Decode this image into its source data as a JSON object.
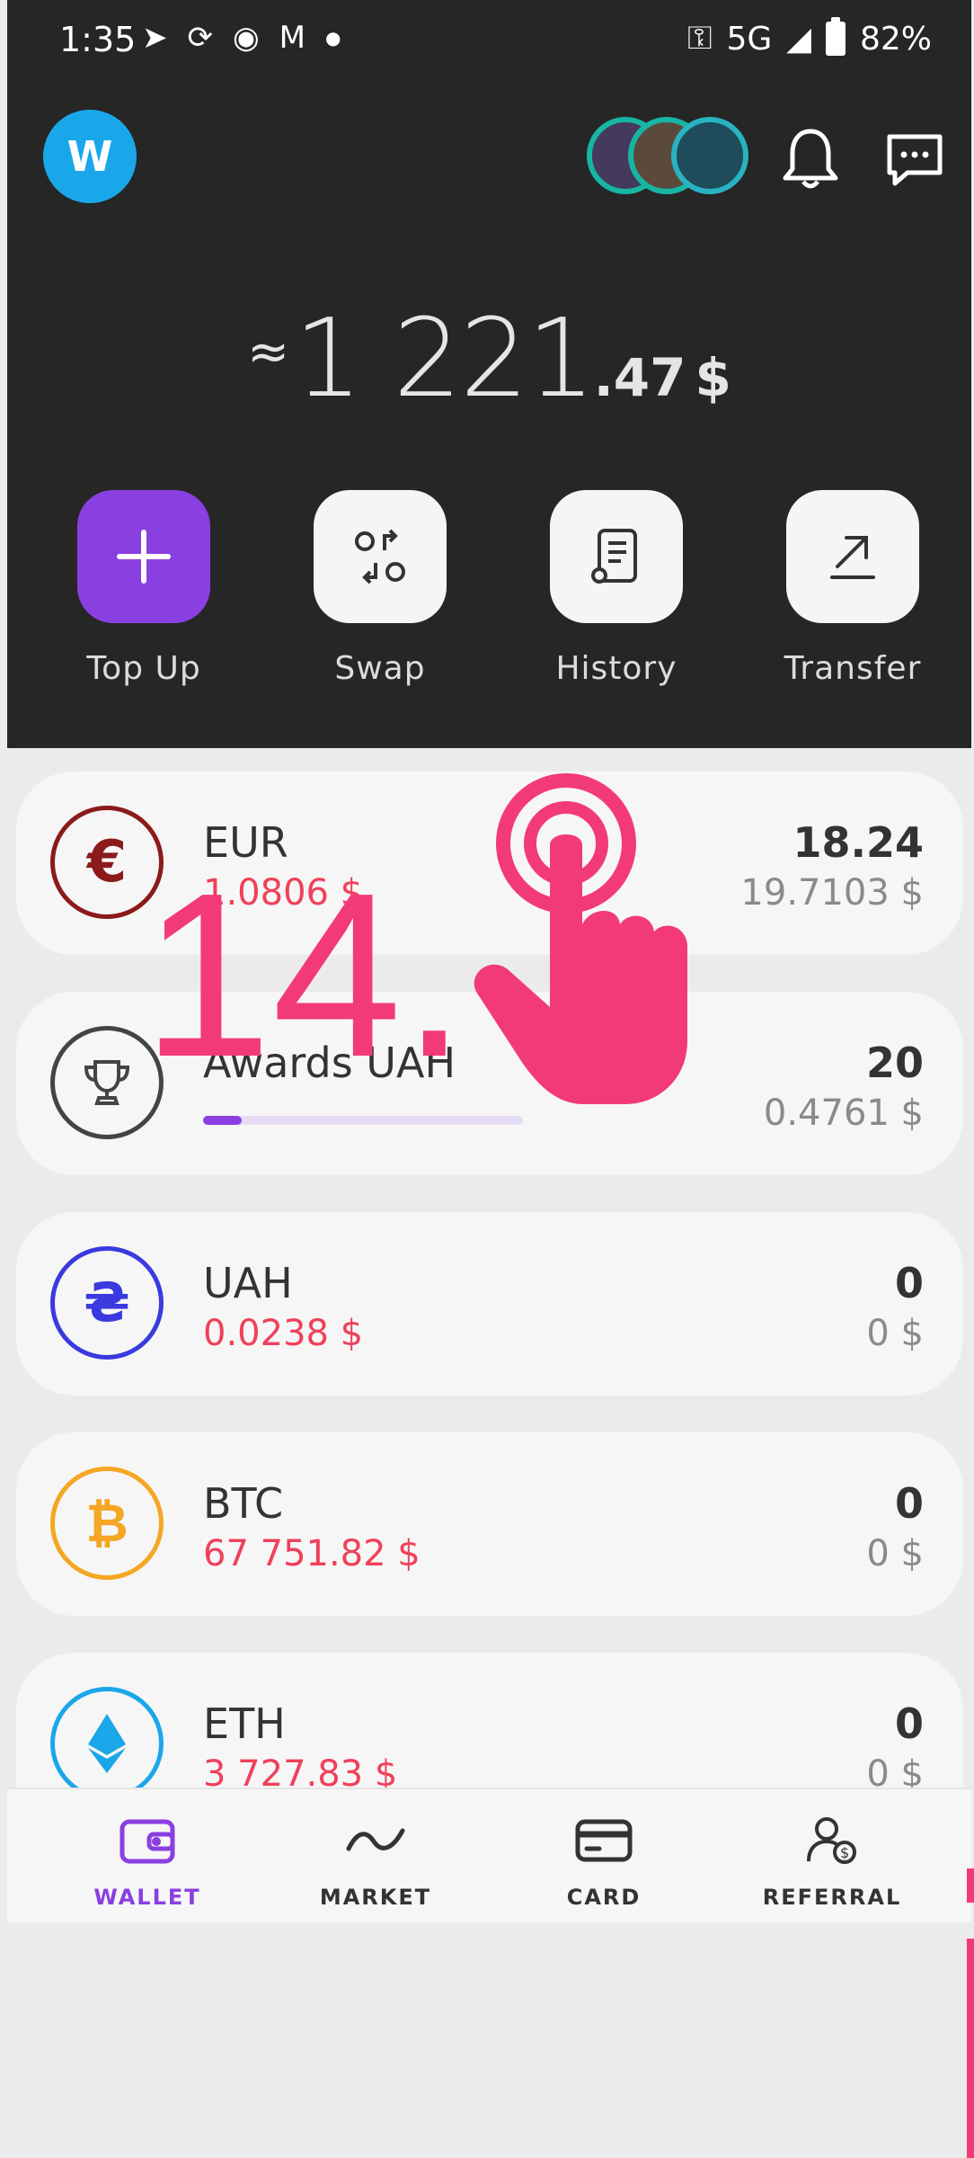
{
  "status_bar": {
    "time": "1:35",
    "network": "5G",
    "battery": "82%"
  },
  "header": {
    "avatar_letter": "W"
  },
  "balance": {
    "approx": "≈",
    "integer": "1 221",
    "decimal": ".47",
    "currency": "$"
  },
  "actions": [
    {
      "label": "Top Up",
      "icon": "plus-icon"
    },
    {
      "label": "Swap",
      "icon": "swap-icon"
    },
    {
      "label": "History",
      "icon": "history-icon"
    },
    {
      "label": "Transfer",
      "icon": "transfer-icon"
    }
  ],
  "assets": [
    {
      "name": "EUR",
      "price": "1.0806 $",
      "amount": "18.24",
      "usd": "19.7103 $",
      "icon": "euro-icon",
      "color": "#8b1a1a"
    },
    {
      "name": "Awards UAH",
      "amount": "20",
      "usd": "0.4761 $",
      "icon": "trophy-icon",
      "color": "#444444",
      "progress": 0.12
    },
    {
      "name": "UAH",
      "price": "0.0238 $",
      "amount": "0",
      "usd": "0 $",
      "icon": "hryvnia-icon",
      "color": "#3a3ae0"
    },
    {
      "name": "BTC",
      "price": "67 751.82 $",
      "amount": "0",
      "usd": "0 $",
      "icon": "bitcoin-icon",
      "color": "#f5a623"
    },
    {
      "name": "ETH",
      "price": "3 727.83 $",
      "amount": "0",
      "usd": "0 $",
      "icon": "ethereum-icon",
      "color": "#1aa7ea"
    }
  ],
  "nav": [
    {
      "label": "WALLET",
      "icon": "wallet-icon",
      "active": true
    },
    {
      "label": "MARKET",
      "icon": "market-icon"
    },
    {
      "label": "CARD",
      "icon": "card-icon"
    },
    {
      "label": "REFERRAL",
      "icon": "referral-icon"
    }
  ],
  "overlay": {
    "step": "14."
  }
}
